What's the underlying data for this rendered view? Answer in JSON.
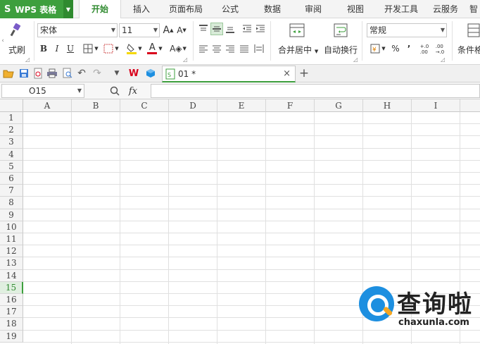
{
  "app": {
    "logo": "S",
    "name": "WPS 表格"
  },
  "menu": {
    "tabs": [
      "开始",
      "插入",
      "页面布局",
      "公式",
      "数据",
      "审阅",
      "视图",
      "开发工具",
      "云服务",
      "智"
    ],
    "active": "开始"
  },
  "ribbon": {
    "format_painter_label": "式刷",
    "font_name": "宋体",
    "font_size": "11",
    "bold": "B",
    "italic": "I",
    "underline": "U",
    "increase_font": "A",
    "decrease_font": "A",
    "font_color_letter": "A",
    "merge_center_label": "合并居中",
    "wrap_text_label": "自动换行",
    "number_format": "常规",
    "percent": "%",
    "comma": "’",
    "inc_decimal": "+.0\n.00",
    "dec_decimal": ".00\n→.0",
    "conditional_label": "条件格"
  },
  "quick_access": {
    "doc_tab_name": "01 *",
    "close_glyph": "×",
    "new_tab_glyph": "+"
  },
  "formula_bar": {
    "name_box": "O15",
    "fx_label": "fx",
    "formula": ""
  },
  "sheet": {
    "columns": [
      "A",
      "B",
      "C",
      "D",
      "E",
      "F",
      "G",
      "H",
      "I"
    ],
    "rows": [
      "1",
      "2",
      "3",
      "4",
      "5",
      "6",
      "7",
      "8",
      "9",
      "10",
      "11",
      "12",
      "13",
      "14",
      "15",
      "16",
      "17",
      "18",
      "19"
    ],
    "active_row": "15"
  },
  "watermark": {
    "cn": "查询啦",
    "en": "chaxunla.com"
  },
  "colors": {
    "accent": "#3d9f3d",
    "brand_blue": "#1d8fe0",
    "highlight_yellow": "#f5d800",
    "font_red": "#d9001b"
  }
}
